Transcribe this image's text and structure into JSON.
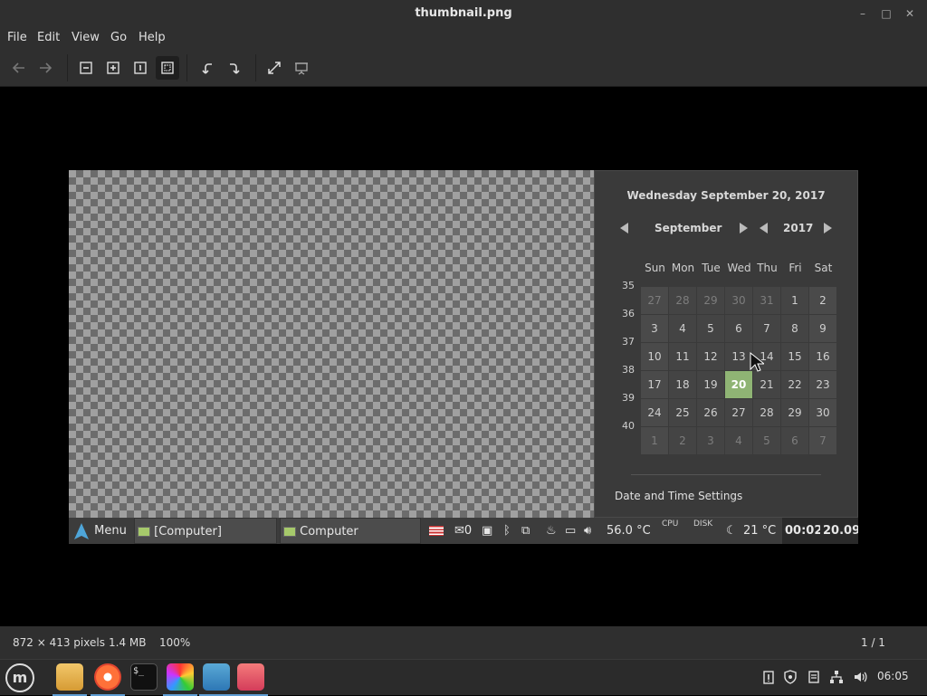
{
  "window": {
    "title": "thumbnail.png",
    "controls": {
      "minimize": "–",
      "maximize": "□",
      "close": "✕"
    }
  },
  "menu": {
    "file": "File",
    "edit": "Edit",
    "view": "View",
    "go": "Go",
    "help": "Help"
  },
  "toolbar_icons": [
    "back-arrow-icon",
    "forward-arrow-icon",
    "zoom-out-icon",
    "zoom-in-icon",
    "zoom-normal-icon",
    "zoom-fit-icon",
    "rotate-left-icon",
    "rotate-right-icon",
    "fullscreen-icon",
    "slideshow-icon"
  ],
  "calendar": {
    "date_heading": "Wednesday September 20, 2017",
    "month": "September",
    "year": "2017",
    "weekdays": [
      "Sun",
      "Mon",
      "Tue",
      "Wed",
      "Thu",
      "Fri",
      "Sat"
    ],
    "week_numbers": [
      "35",
      "36",
      "37",
      "38",
      "39",
      "40"
    ],
    "weeks": [
      [
        "27",
        "28",
        "29",
        "30",
        "31",
        "1",
        "2"
      ],
      [
        "3",
        "4",
        "5",
        "6",
        "7",
        "8",
        "9"
      ],
      [
        "10",
        "11",
        "12",
        "13",
        "14",
        "15",
        "16"
      ],
      [
        "17",
        "18",
        "19",
        "20",
        "21",
        "22",
        "23"
      ],
      [
        "24",
        "25",
        "26",
        "27",
        "28",
        "29",
        "30"
      ],
      [
        "1",
        "2",
        "3",
        "4",
        "5",
        "6",
        "7"
      ]
    ],
    "today": "20",
    "settings_link": "Date and Time Settings"
  },
  "panel": {
    "menu_label": "Menu",
    "task1": "[Computer]",
    "task2": "Computer",
    "mail_count": "0",
    "temp_cpu": "56.0 °C",
    "cpu_label": "CPU",
    "disk_label": "DISK",
    "weather": "21 °C",
    "time1": "00:02",
    "time2": "20.09"
  },
  "status": {
    "dimensions": "872 × 413 pixels",
    "size": "1.4 MB",
    "zoom": "100%",
    "page": "1 / 1"
  },
  "taskbar": {
    "apps": [
      "files-icon",
      "firefox-icon",
      "terminal-icon",
      "drawing-icon",
      "update-manager-icon",
      "image-viewer-icon"
    ],
    "clock": "06:05"
  }
}
